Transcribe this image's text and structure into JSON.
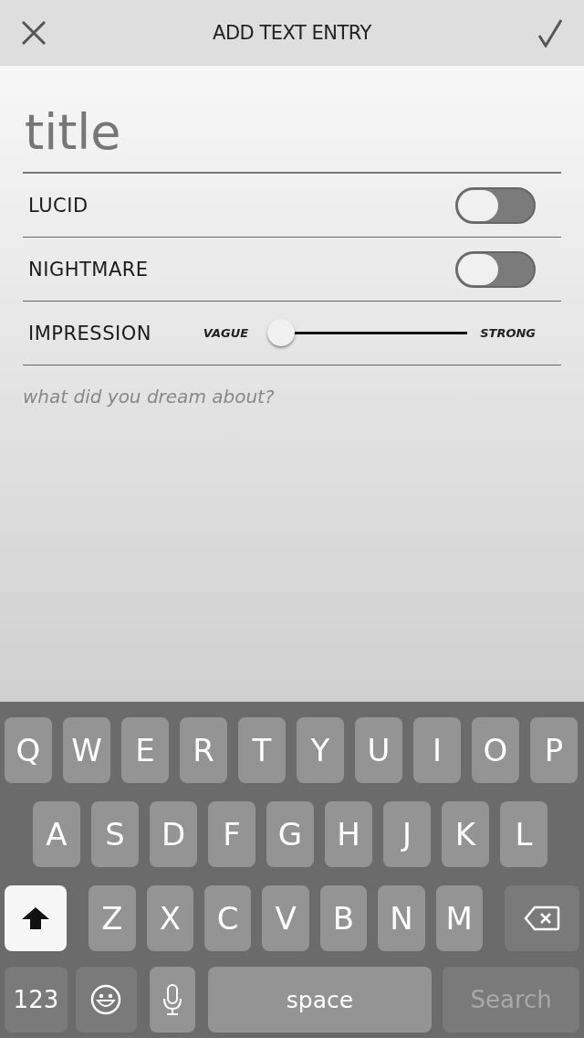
{
  "header": {
    "title": "ADD TEXT ENTRY"
  },
  "title_field": {
    "placeholder": "title"
  },
  "toggles": [
    {
      "label": "LUCID",
      "on": false
    },
    {
      "label": "NIGHTMARE",
      "on": false
    }
  ],
  "impression": {
    "label": "IMPRESSION",
    "min_label": "VAGUE",
    "max_label": "STRONG",
    "level": 0.03
  },
  "notes_field": {
    "placeholder": "what did you dream about?"
  },
  "keyboard": {
    "letter_rows": [
      [
        "Q",
        "W",
        "E",
        "R",
        "T",
        "Y",
        "U",
        "I",
        "O",
        "P"
      ],
      [
        "A",
        "S",
        "D",
        "F",
        "G",
        "H",
        "J",
        "K",
        "L"
      ],
      [
        "Z",
        "X",
        "C",
        "V",
        "B",
        "N",
        "M"
      ]
    ],
    "shift": {
      "on": true
    },
    "numbers_key": "123",
    "space_key": "space",
    "return_key": {
      "label": "Search",
      "disabled": true
    }
  }
}
